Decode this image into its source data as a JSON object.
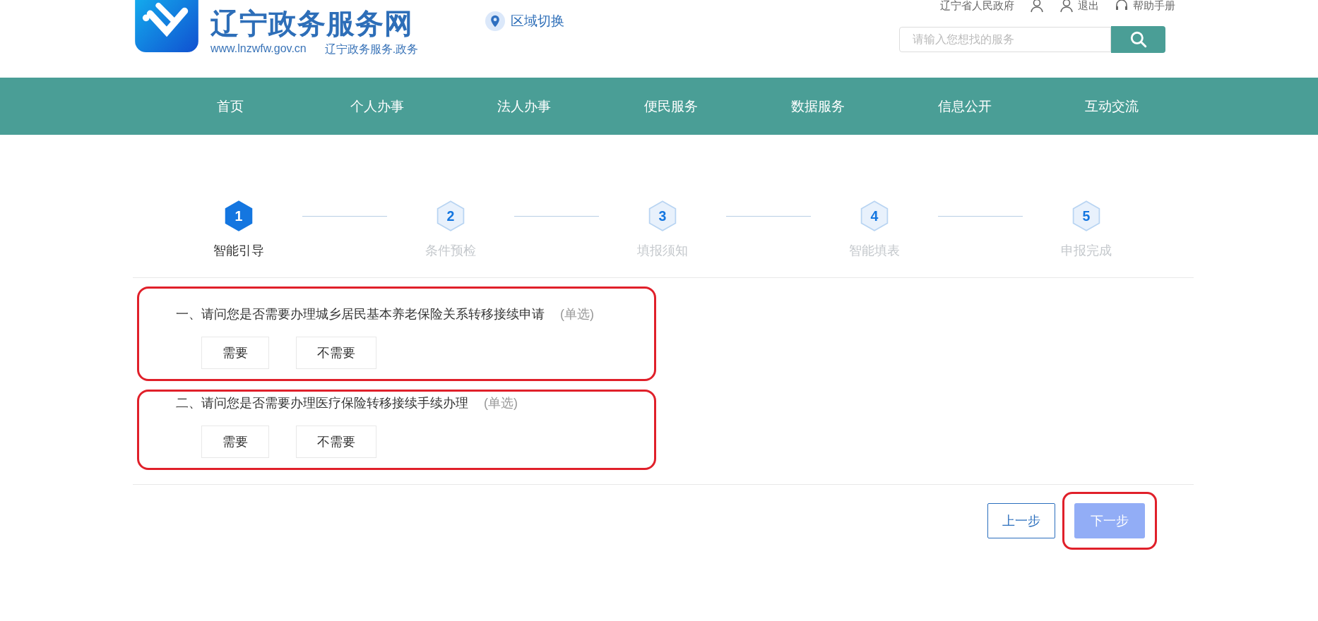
{
  "header": {
    "site_title": "辽宁政务服务网",
    "site_url": "www.lnzwfw.gov.cn",
    "site_domain": "辽宁政务服务.政务",
    "region_switch": "区域切换",
    "top_links": [
      {
        "kind": "text",
        "label": "辽宁省人民政府"
      },
      {
        "kind": "user"
      },
      {
        "kind": "logout",
        "label": "退出"
      },
      {
        "kind": "help",
        "label": "帮助手册"
      }
    ],
    "search": {
      "placeholder": "请输入您想找的服务"
    }
  },
  "nav": [
    {
      "label": "首页"
    },
    {
      "label": "个人办事"
    },
    {
      "label": "法人办事"
    },
    {
      "label": "便民服务"
    },
    {
      "label": "数据服务"
    },
    {
      "label": "信息公开"
    },
    {
      "label": "互动交流"
    }
  ],
  "steps": [
    {
      "number": "1",
      "label": "智能引导",
      "selected": true
    },
    {
      "number": "2",
      "label": "条件预检",
      "selected": false
    },
    {
      "number": "3",
      "label": "填报须知",
      "selected": false
    },
    {
      "number": "4",
      "label": "智能填表",
      "selected": false
    },
    {
      "number": "5",
      "label": "申报完成",
      "selected": false
    }
  ],
  "questions": [
    {
      "text": "一、请问您是否需要办理城乡居民基本养老保险关系转移接续申请",
      "hint": "(单选)",
      "highlighted": true,
      "options": [
        {
          "label": "需要",
          "selected": false
        },
        {
          "label": "不需要",
          "selected": false
        }
      ]
    },
    {
      "text": "二、请问您是否需要办理医疗保险转移接续手续办理",
      "hint": "(单选)",
      "highlighted": true,
      "options": [
        {
          "label": "需要",
          "selected": false
        },
        {
          "label": "不需要",
          "selected": false
        }
      ]
    }
  ],
  "buttons": {
    "prev": {
      "label": "上一步"
    },
    "next": {
      "label": "下一步",
      "disabled": true,
      "highlighted": true
    }
  }
}
